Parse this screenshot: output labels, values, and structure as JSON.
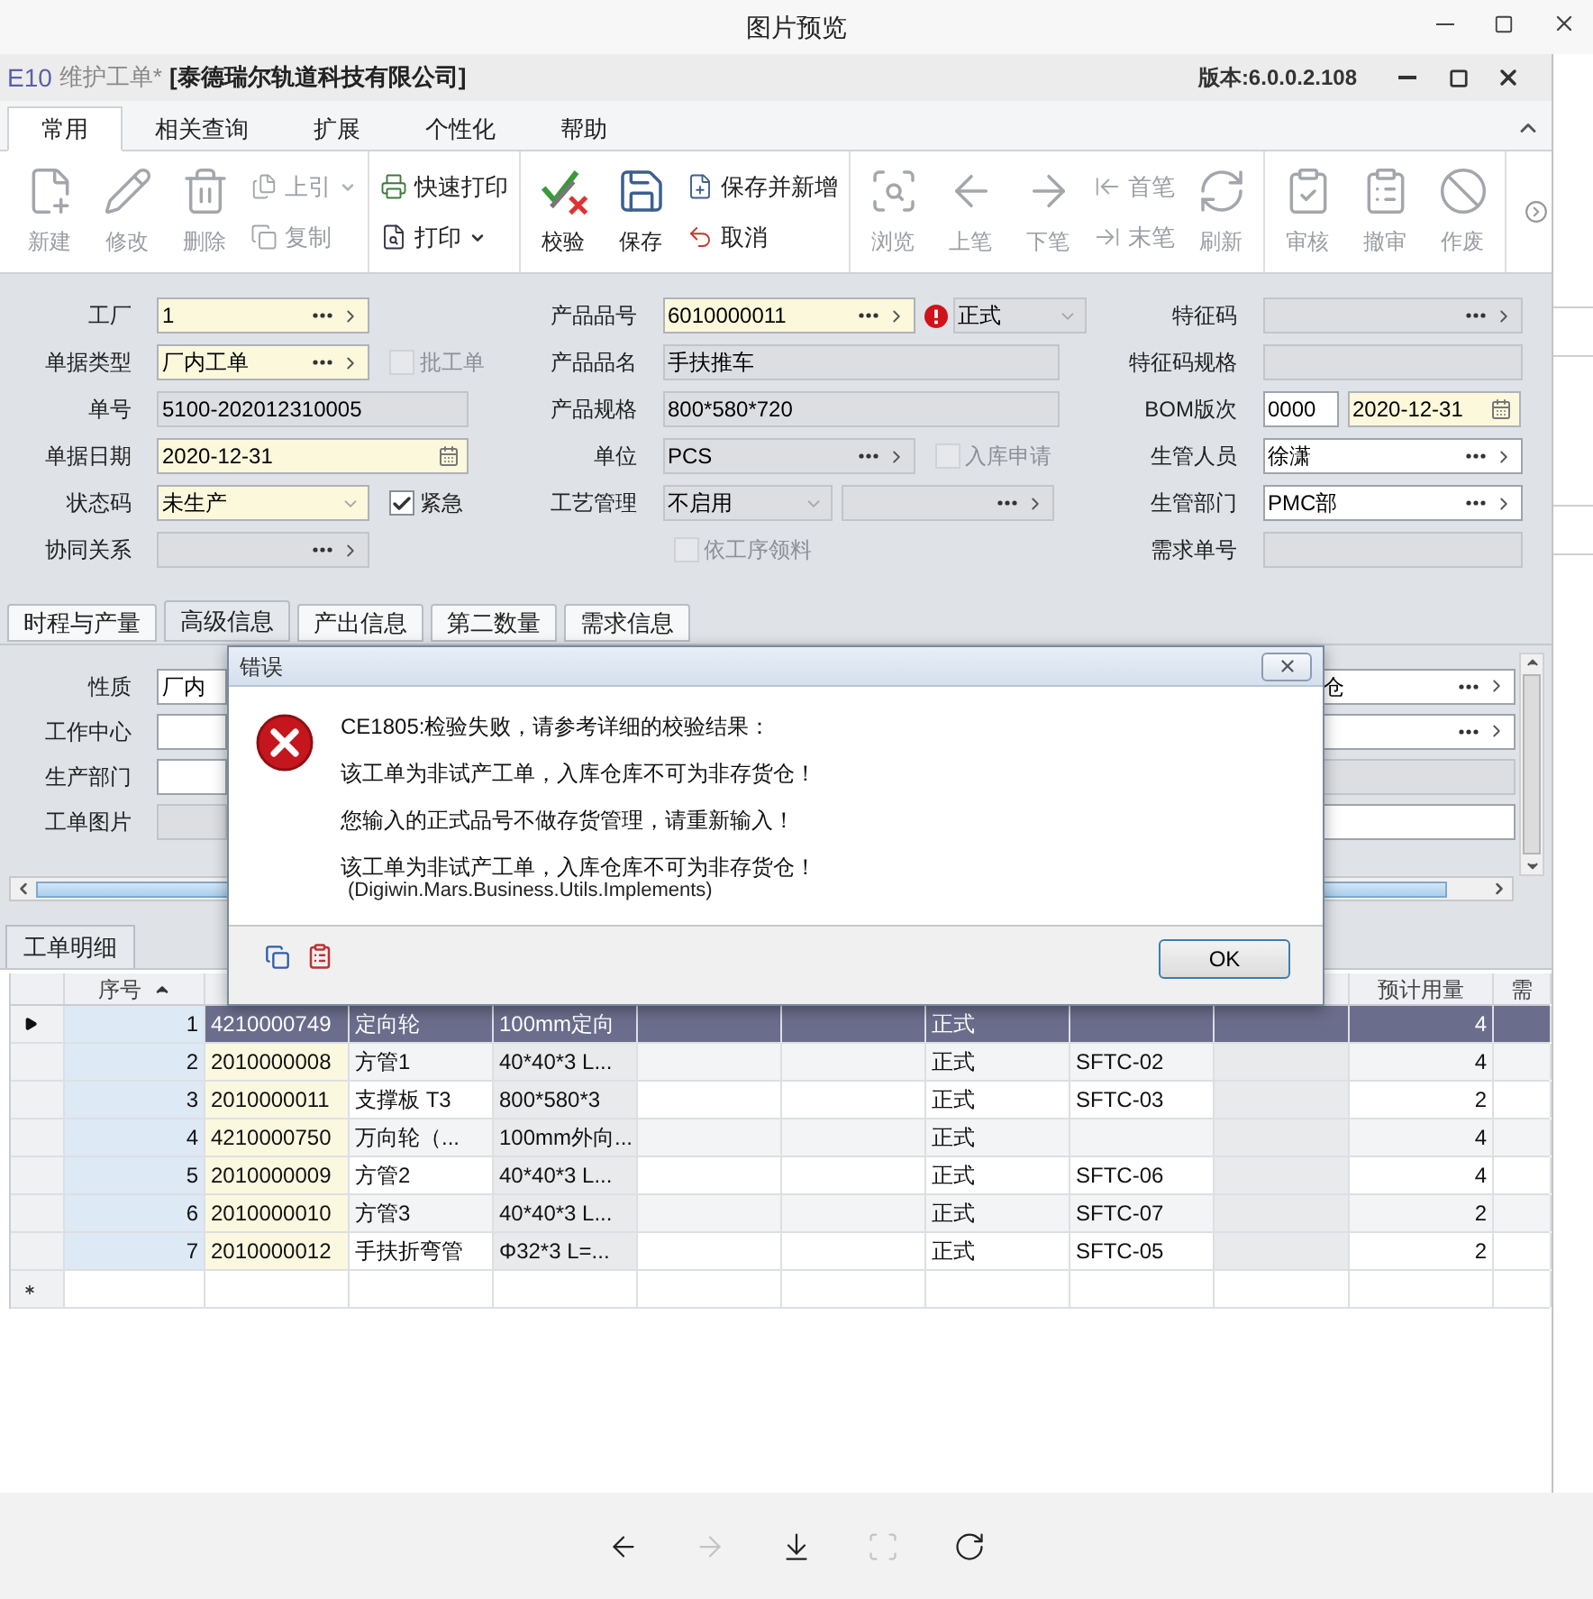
{
  "viewer": {
    "title": "图片预览",
    "toolbar": [
      {
        "kind": "back",
        "disabled": false
      },
      {
        "kind": "forward",
        "disabled": true
      },
      {
        "kind": "download",
        "disabled": false
      },
      {
        "kind": "fit",
        "disabled": true
      },
      {
        "kind": "rotate",
        "disabled": false
      }
    ]
  },
  "app": {
    "logo": "E10",
    "title": "维护工单*",
    "company": "[泰德瑞尔轨道科技有限公司]",
    "version": "版本:6.0.0.2.108"
  },
  "ribbon_tabs": [
    {
      "label": "常用",
      "selected": true
    },
    {
      "label": "相关查询",
      "selected": false
    },
    {
      "label": "扩展",
      "selected": false
    },
    {
      "label": "个性化",
      "selected": false
    },
    {
      "label": "帮助",
      "selected": false
    }
  ],
  "ribbon_groups": [
    [
      {
        "kind": "large",
        "label": "新建",
        "disabled": true
      },
      {
        "kind": "large",
        "label": "修改",
        "disabled": true
      },
      {
        "kind": "large",
        "label": "删除",
        "disabled": true
      },
      {
        "kind": "stack",
        "items": [
          {
            "label": "上引",
            "disabled": true,
            "dropdown": true
          },
          {
            "label": "复制",
            "disabled": true,
            "dropdown": false
          }
        ]
      }
    ],
    [
      {
        "kind": "stack",
        "items": [
          {
            "label": "快速打印",
            "disabled": false,
            "dropdown": false
          },
          {
            "label": "打印",
            "disabled": false,
            "dropdown": true
          }
        ]
      }
    ],
    [
      {
        "kind": "large",
        "label": "校验",
        "disabled": false
      },
      {
        "kind": "large",
        "label": "保存",
        "disabled": false
      },
      {
        "kind": "stack",
        "items": [
          {
            "label": "保存并新增",
            "disabled": false,
            "dropdown": false
          },
          {
            "label": "取消",
            "disabled": false,
            "dropdown": false
          }
        ]
      }
    ],
    [
      {
        "kind": "large",
        "label": "浏览",
        "disabled": true
      },
      {
        "kind": "large",
        "label": "上笔",
        "disabled": true
      },
      {
        "kind": "large",
        "label": "下笔",
        "disabled": true
      },
      {
        "kind": "stack",
        "items": [
          {
            "label": "首笔",
            "disabled": true,
            "dropdown": false
          },
          {
            "label": "末笔",
            "disabled": true,
            "dropdown": false
          }
        ]
      },
      {
        "kind": "large",
        "label": "刷新",
        "disabled": true
      }
    ],
    [
      {
        "kind": "large",
        "label": "审核",
        "disabled": true
      },
      {
        "kind": "large",
        "label": "撤审",
        "disabled": true
      },
      {
        "kind": "large",
        "label": "作废",
        "disabled": true
      }
    ]
  ],
  "form": {
    "columns": [
      [
        {
          "label": "工厂",
          "fields": [
            {
              "kind": "lookup",
              "required": true,
              "disabled": false,
              "value": "1"
            }
          ]
        },
        {
          "label": "单据类型",
          "fields": [
            {
              "kind": "lookup",
              "required": true,
              "disabled": false,
              "value": "厂内工单"
            },
            {
              "kind": "checkbox",
              "label": "批工单",
              "checked": false,
              "disabled": true
            }
          ]
        },
        {
          "label": "单号",
          "fields": [
            {
              "kind": "text",
              "required": false,
              "disabled": true,
              "value": "5100-202012310005"
            }
          ]
        },
        {
          "label": "单据日期",
          "fields": [
            {
              "kind": "date",
              "required": true,
              "disabled": false,
              "value": "2020-12-31"
            }
          ]
        },
        {
          "label": "状态码",
          "fields": [
            {
              "kind": "combo",
              "required": true,
              "disabled": false,
              "value": "未生产"
            },
            {
              "kind": "checkbox",
              "label": "紧急",
              "checked": true,
              "disabled": false
            }
          ]
        },
        {
          "label": "协同关系",
          "fields": [
            {
              "kind": "lookup",
              "required": false,
              "disabled": true
            }
          ]
        }
      ],
      [
        {
          "label": "产品品号",
          "fields": [
            {
              "kind": "lookup",
              "required": true,
              "disabled": false,
              "value": "6010000011"
            },
            {
              "kind": "combo",
              "required": false,
              "disabled": true,
              "value": "正式",
              "error": true
            }
          ]
        },
        {
          "label": "产品品名",
          "fields": [
            {
              "kind": "text",
              "required": false,
              "disabled": true,
              "value": "手扶推车"
            }
          ]
        },
        {
          "label": "产品规格",
          "fields": [
            {
              "kind": "text",
              "required": false,
              "disabled": true,
              "value": "800*580*720"
            }
          ]
        },
        {
          "label": "单位",
          "fields": [
            {
              "kind": "lookup",
              "required": false,
              "disabled": true,
              "value": "PCS"
            },
            {
              "kind": "checkbox",
              "label": "入库申请",
              "checked": false,
              "disabled": true
            }
          ]
        },
        {
          "label": "工艺管理",
          "fields": [
            {
              "kind": "combo",
              "required": false,
              "disabled": true,
              "value": "不启用"
            },
            {
              "kind": "lookup",
              "required": false,
              "disabled": true
            }
          ]
        },
        {
          "fields": [
            {
              "kind": "checkbox",
              "label": "依工序领料",
              "checked": false,
              "disabled": true
            }
          ]
        }
      ],
      [
        {
          "label": "特征码",
          "fields": [
            {
              "kind": "lookup",
              "required": false,
              "disabled": true
            }
          ]
        },
        {
          "label": "特征码规格",
          "fields": [
            {
              "kind": "text",
              "required": false,
              "disabled": true
            }
          ]
        },
        {
          "label": "BOM版次",
          "fields": [
            {
              "kind": "text",
              "required": false,
              "disabled": false,
              "value": "0000"
            },
            {
              "kind": "date",
              "required": true,
              "disabled": false,
              "value": "2020-12-31"
            }
          ]
        },
        {
          "label": "生管人员",
          "fields": [
            {
              "kind": "lookup",
              "required": false,
              "disabled": false,
              "value": "徐潇"
            }
          ]
        },
        {
          "label": "生管部门",
          "fields": [
            {
              "kind": "lookup",
              "required": false,
              "disabled": false,
              "value": "PMC部"
            }
          ]
        },
        {
          "label": "需求单号",
          "fields": [
            {
              "kind": "text",
              "required": false,
              "disabled": true
            }
          ]
        }
      ]
    ]
  },
  "subtabs": [
    {
      "label": "时程与产量",
      "selected": false
    },
    {
      "label": "高级信息",
      "selected": true
    },
    {
      "label": "产出信息",
      "selected": false
    },
    {
      "label": "第二数量",
      "selected": false
    },
    {
      "label": "需求信息",
      "selected": false
    }
  ],
  "subpanel": {
    "rows": [
      {
        "label": "性质",
        "left": {
          "kind": "text",
          "required": false,
          "disabled": false,
          "value": "厂内"
        },
        "right": {
          "kind": "lookup",
          "required": false,
          "disabled": false,
          "value": "仓"
        }
      },
      {
        "label": "工作中心",
        "left": {
          "kind": "text",
          "required": false,
          "disabled": false
        },
        "right": {
          "kind": "lookup",
          "required": false,
          "disabled": false
        }
      },
      {
        "label": "生产部门",
        "left": {
          "kind": "text",
          "required": false,
          "disabled": false
        },
        "right": {
          "kind": "text",
          "required": false,
          "disabled": true
        }
      },
      {
        "label": "工单图片",
        "left": {
          "kind": "text",
          "required": false,
          "disabled": true
        },
        "right": {
          "kind": "text",
          "required": false,
          "disabled": false
        }
      }
    ]
  },
  "dialog": {
    "title": "错误",
    "summary": "CE1805:检验失败，请参考详细的校验结果：",
    "messages": [
      "该工单为非试产工单，入库仓库不可为非存货仓！",
      "您输入的正式品号不做存货管理，请重新输入！",
      "该工单为非试产工单，入库仓库不可为非存货仓！"
    ],
    "detail": "(Digiwin.Mars.Business.Utils.Implements)",
    "ok": "OK"
  },
  "grid": {
    "tab": "工单明细",
    "columns": [
      {
        "label": "序号",
        "sorted": true
      },
      {
        "label": "预计用量",
        "sorted": false
      },
      {
        "label": "需",
        "sorted": false
      }
    ],
    "rows": [
      {
        "seq": "1",
        "item_no": "4210000749",
        "name": "定向轮",
        "spec": "100mm定向",
        "type": "正式",
        "qty": "4",
        "selected": true
      },
      {
        "seq": "2",
        "item_no": "2010000008",
        "name": "方管1",
        "spec": "40*40*3 L...",
        "type": "正式",
        "code": "SFTC-02",
        "qty": "4",
        "selected": false
      },
      {
        "seq": "3",
        "item_no": "2010000011",
        "name": "支撑板 T3",
        "spec": "800*580*3",
        "type": "正式",
        "code": "SFTC-03",
        "qty": "2",
        "selected": false
      },
      {
        "seq": "4",
        "item_no": "4210000750",
        "name": "万向轮（...",
        "spec": "100mm外向...",
        "type": "正式",
        "qty": "4",
        "selected": false
      },
      {
        "seq": "5",
        "item_no": "2010000009",
        "name": "方管2",
        "spec": "40*40*3 L...",
        "type": "正式",
        "code": "SFTC-06",
        "qty": "4",
        "selected": false
      },
      {
        "seq": "6",
        "item_no": "2010000010",
        "name": "方管3",
        "spec": "40*40*3 L...",
        "type": "正式",
        "code": "SFTC-07",
        "qty": "2",
        "selected": false
      },
      {
        "seq": "7",
        "item_no": "2010000012",
        "name": "手扶折弯管",
        "spec": "Φ32*3 L=...",
        "type": "正式",
        "code": "SFTC-05",
        "qty": "2",
        "selected": false
      }
    ]
  }
}
